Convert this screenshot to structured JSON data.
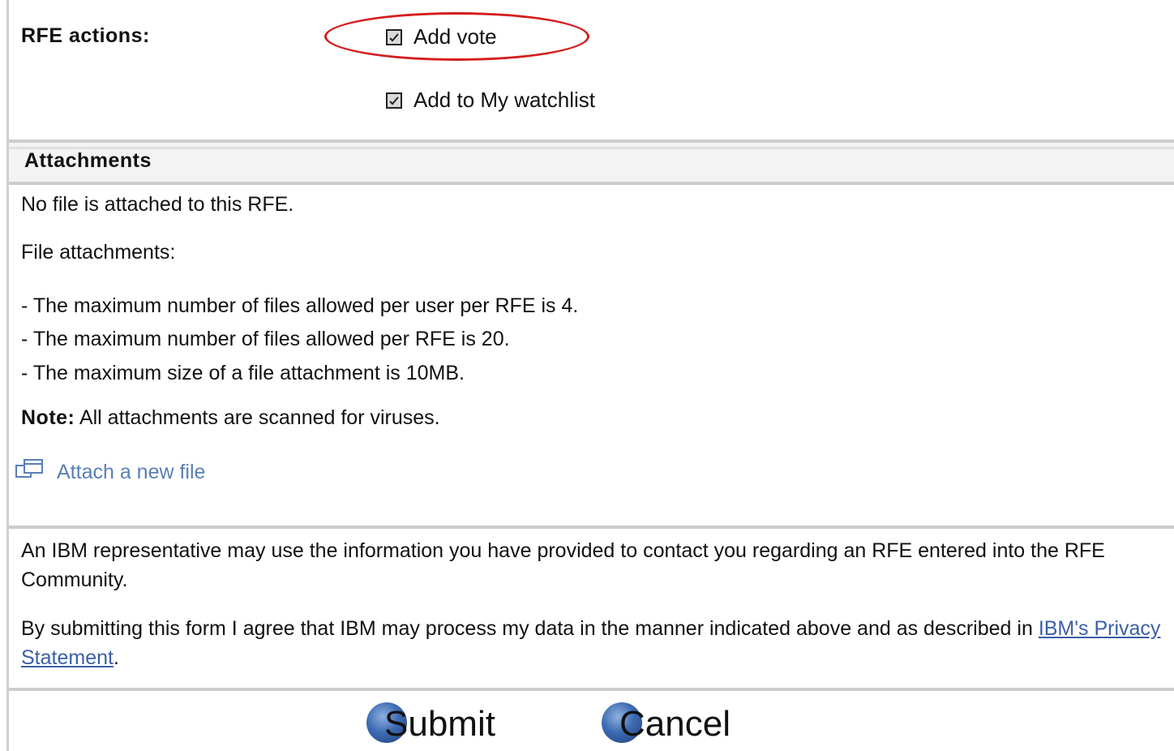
{
  "rfe_actions": {
    "label": "RFE actions:",
    "add_vote": "Add vote",
    "add_watchlist": "Add to My watchlist"
  },
  "attachments": {
    "title": "Attachments",
    "no_file": "No file is attached to this RFE.",
    "file_attachments_heading": "File attachments:",
    "rules": [
      "- The maximum number of files allowed per user per RFE is 4.",
      "- The maximum number of files allowed per RFE is 20.",
      "- The maximum size of a file attachment is 10MB."
    ],
    "note_label": "Note:",
    "note_text": " All attachments are scanned for viruses.",
    "attach_link": "Attach a new file"
  },
  "consent": {
    "paragraph1": "An IBM representative may use the information you have provided to contact you regarding an RFE entered into the RFE Community.",
    "paragraph2_prefix": "By submitting this form I agree that IBM may process my data in the manner indicated above and as described in ",
    "privacy_link": "IBM's Privacy Statement",
    "paragraph2_suffix": "."
  },
  "buttons": {
    "submit": "Submit",
    "cancel": "Cancel"
  },
  "colors": {
    "highlight": "#d41d1d",
    "link": "#3b5fa8",
    "attach_link": "#5a7fb5",
    "button_orb": "#3d6bb3"
  },
  "icons": {
    "vote_checkbox": "checked-checkbox-icon",
    "watchlist_checkbox": "checked-checkbox-icon",
    "attach": "attach-file-icon"
  }
}
